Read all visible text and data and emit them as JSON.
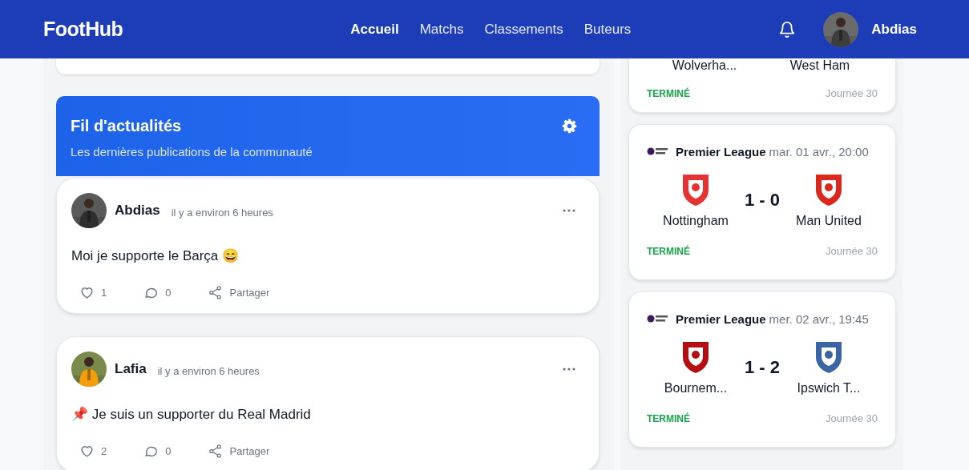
{
  "header": {
    "logo": "FootHub",
    "nav": [
      {
        "label": "Accueil",
        "selected": true
      },
      {
        "label": "Matchs",
        "selected": false
      },
      {
        "label": "Classements",
        "selected": false
      },
      {
        "label": "Buteurs",
        "selected": false
      }
    ],
    "user": {
      "name": "Abdias"
    }
  },
  "feed": {
    "title": "Fil d'actualités",
    "subtitle": "Les dernières publications de la communauté",
    "posts": [
      {
        "author": "Abdias",
        "time": "il y a environ 6 heures",
        "text": "Moi je supporte le Barça 😄",
        "likes": "1",
        "comments": "0",
        "share": "Partager"
      },
      {
        "author": "Lafia",
        "time": "il y a environ 6 heures",
        "text": "📌 Je suis un supporter du Real Madrid",
        "likes": "2",
        "comments": "0",
        "share": "Partager"
      }
    ]
  },
  "matches": [
    {
      "home": {
        "name": "Wolverha..."
      },
      "away": {
        "name": "West Ham"
      },
      "status": "TERMINÉ",
      "round": "Journée 30"
    },
    {
      "league": "Premier League",
      "date": "mar. 01 avr., 20:00",
      "home": {
        "name": "Nottingham",
        "color": "#e53233"
      },
      "away": {
        "name": "Man United",
        "color": "#da291c"
      },
      "score": "1 - 0",
      "status": "TERMINÉ",
      "round": "Journée 30"
    },
    {
      "league": "Premier League",
      "date": "mer. 02 avr., 19:45",
      "home": {
        "name": "Bournem...",
        "color": "#b50e12"
      },
      "away": {
        "name": "Ipswich T...",
        "color": "#3a64a3"
      },
      "score": "1 - 2",
      "status": "TERMINÉ",
      "round": "Journée 30"
    }
  ]
}
